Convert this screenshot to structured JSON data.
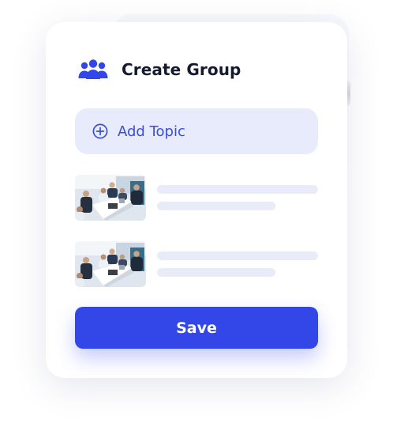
{
  "card": {
    "title": "Create Group",
    "title_icon": "users-group-icon",
    "add_topic": {
      "label": "Add Topic",
      "icon": "plus-circle-icon"
    },
    "items": [
      {
        "thumbnail": "meeting-photo",
        "text_lines": "placeholder"
      },
      {
        "thumbnail": "meeting-photo",
        "text_lines": "placeholder"
      }
    ],
    "save_label": "Save"
  },
  "colors": {
    "accent": "#3347e8",
    "accent_light": "#e7ebfb",
    "accent_text": "#3a4fd6",
    "title_text": "#161a2e",
    "placeholder_line": "#e9ecf8"
  }
}
